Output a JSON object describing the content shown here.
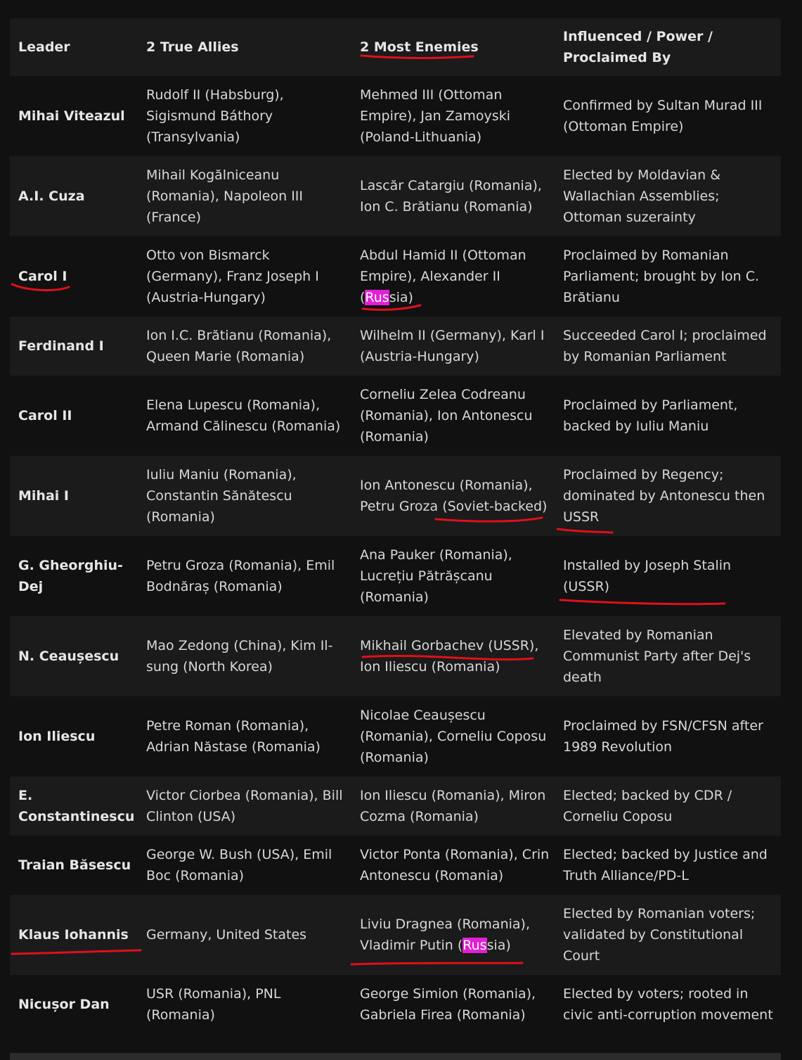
{
  "table": {
    "headers": [
      "Leader",
      "2 True Allies",
      "2 Most Enemies",
      "Influenced / Power / Proclaimed By"
    ],
    "rows": [
      {
        "leader": "Mihai Viteazul",
        "allies": "Rudolf II (Habsburg), Sigismund Báthory (Transylvania)",
        "enemies": "Mehmed III (Ottoman Empire), Jan Zamoyski (Poland-Lithuania)",
        "influence": "Confirmed by Sultan Murad III (Ottoman Empire)"
      },
      {
        "leader": "A.I. Cuza",
        "allies": "Mihail Kogălniceanu (Romania), Napoleon III (France)",
        "enemies": "Lascăr Catargiu (Romania), Ion C. Brătianu (Romania)",
        "influence": "Elected by Moldavian & Wallachian Assemblies; Ottoman suzerainty"
      },
      {
        "leader": "Carol I",
        "allies": "Otto von Bismarck (Germany), Franz Joseph I (Austria-Hungary)",
        "enemies_pre": "Abdul Hamid II (Ottoman Empire), Alexander II (",
        "enemies_hl": "Rus",
        "enemies_post": "sia)",
        "influence": "Proclaimed by Romanian Parliament; brought by Ion C. Brătianu"
      },
      {
        "leader": "Ferdinand I",
        "allies": "Ion I.C. Brătianu (Romania), Queen Marie (Romania)",
        "enemies": "Wilhelm II (Germany), Karl I (Austria-Hungary)",
        "influence": "Succeeded Carol I; proclaimed by Romanian Parliament"
      },
      {
        "leader": "Carol II",
        "allies": "Elena Lupescu (Romania), Armand Călinescu (Romania)",
        "enemies": "Corneliu Zelea Codreanu (Romania), Ion Antonescu (Romania)",
        "influence": "Proclaimed by Parliament, backed by Iuliu Maniu"
      },
      {
        "leader": "Mihai I",
        "allies": "Iuliu Maniu (Romania), Constantin Sănătescu (Romania)",
        "enemies": "Ion Antonescu (Romania), Petru Groza (Soviet-backed)",
        "influence": "Proclaimed by Regency; dominated by Antonescu then USSR"
      },
      {
        "leader": "G. Gheorghiu-Dej",
        "allies": "Petru Groza (Romania), Emil Bodnăraș (Romania)",
        "enemies": "Ana Pauker (Romania), Lucrețiu Pătrășcanu (Romania)",
        "influence": "Installed by Joseph Stalin (USSR)"
      },
      {
        "leader": "N. Ceaușescu",
        "allies": "Mao Zedong (China), Kim Il-sung (North Korea)",
        "enemies": "Mikhail Gorbachev (USSR), Ion Iliescu (Romania)",
        "influence": "Elevated by Romanian Communist Party after Dej's death"
      },
      {
        "leader": "Ion Iliescu",
        "allies": "Petre Roman (Romania), Adrian Năstase (Romania)",
        "enemies": "Nicolae Ceaușescu (Romania), Corneliu Coposu (Romania)",
        "influence": "Proclaimed by FSN/CFSN after 1989 Revolution"
      },
      {
        "leader": "E. Constantinescu",
        "allies": "Victor Ciorbea (Romania), Bill Clinton (USA)",
        "enemies": "Ion Iliescu (Romania), Miron Cozma (Romania)",
        "influence": "Elected; backed by CDR / Corneliu Coposu"
      },
      {
        "leader": "Traian Băsescu",
        "allies": "George W. Bush (USA), Emil Boc (Romania)",
        "enemies": "Victor Ponta (Romania), Crin Antonescu (Romania)",
        "influence": "Elected; backed by Justice and Truth Alliance/PD-L"
      },
      {
        "leader": "Klaus Iohannis",
        "allies": "Germany, United States",
        "enemies_pre": "Liviu Dragnea (Romania), Vladimir Putin (",
        "enemies_hl": "Rus",
        "enemies_post": "sia)",
        "influence": "Elected by Romanian voters; validated by Constitutional Court"
      },
      {
        "leader": "Nicușor Dan",
        "allies": "USR (Romania), PNL (Romania)",
        "enemies": "George Simion (Romania), Gabriela Firea (Romania)",
        "influence": "Elected by voters; rooted in civic anti-corruption movement"
      }
    ]
  },
  "colors": {
    "background": "#111111",
    "row_alt": "#1b1b1b",
    "highlight": "#e21fd6",
    "annotation": "#e0101a"
  }
}
